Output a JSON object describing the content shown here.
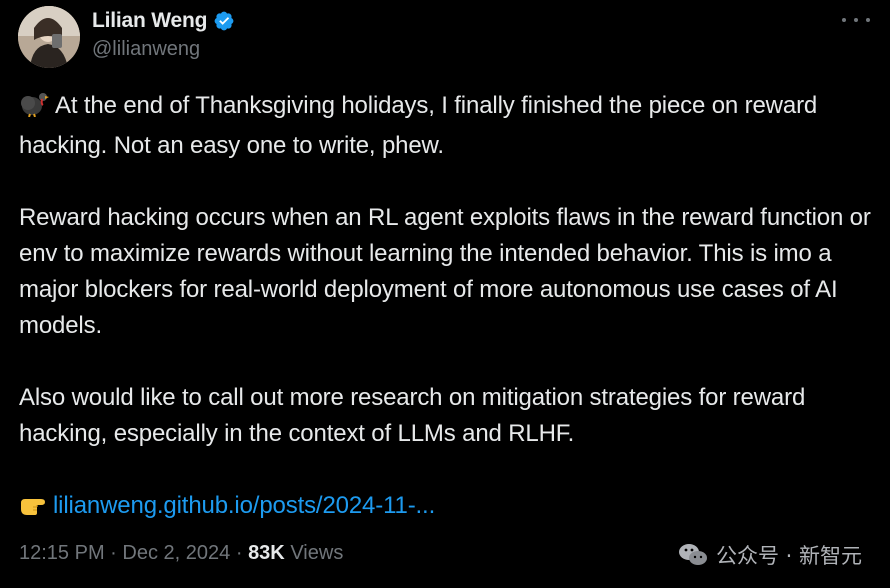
{
  "author": {
    "display_name": "Lilian Weng",
    "handle": "@lilianweng",
    "verified": true
  },
  "tweet": {
    "paragraphs": [
      "At the end of Thanksgiving holidays, I finally finished the piece on reward hacking. Not an easy one to write, phew.",
      "Reward hacking occurs when an RL agent exploits flaws in the reward function or env to maximize rewards without learning the intended behavior. This is imo a major blockers for real-world deployment of more autonomous use cases of AI models.",
      "Also would like to call out more research on mitigation strategies for reward hacking, especially in the context of LLMs and RLHF."
    ],
    "first_paragraph_emoji": "turkey-emoji",
    "link_emoji": "pointing-right-emoji",
    "link_text": "lilianweng.github.io/posts/2024-11-..."
  },
  "meta": {
    "time": "12:15 PM",
    "separator": "·",
    "date": "Dec 2, 2024",
    "views_count": "83K",
    "views_label": "Views"
  },
  "watermark": {
    "text": "公众号 · 新智元",
    "icon": "wechat-icon"
  },
  "colors": {
    "background": "#000000",
    "text": "#e7e9ea",
    "secondary": "#71767b",
    "link": "#1d9bf0",
    "verified": "#1d9bf0"
  }
}
